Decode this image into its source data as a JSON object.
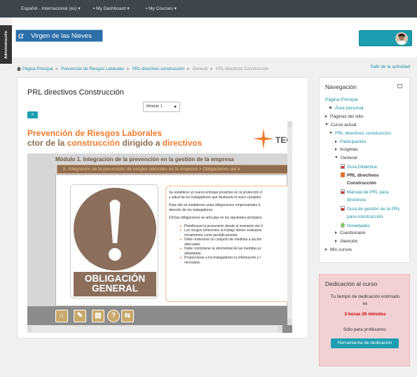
{
  "topbar": {
    "language": "Español - Internacional (es)",
    "dashboard": "My Dashboard",
    "courses": "My Courses"
  },
  "admin_tab": {
    "label": "Administración"
  },
  "header": {
    "logo_text": "Virgen de las Nieves",
    "logo_glyph": "α"
  },
  "breadcrumb": {
    "items": [
      "Página Principal",
      "Prevención de Riesgos Laborales",
      "PRL directivos construcción",
      "General",
      "PRL directivos Construcción"
    ],
    "separator": "►"
  },
  "exit_link": "Salir de la actividad",
  "main": {
    "title": "PRL directivos Construcción",
    "module_select": "Módulo 1",
    "next_button": ">"
  },
  "slide": {
    "title_line1": "Prevención de Riesgos Laborales",
    "title_line2_a": "ctor de la ",
    "title_line2_b": "construcción",
    "title_line2_c": " dirigido a ",
    "title_line2_d": "directivos",
    "logo_text": "TEC",
    "module_heading": "Módulo 1. Integración de la prevención en la gestión de la empresa",
    "section_heading": "5. Integración de la prevención de riesgos laborales en la empresa > Obligaciones del e",
    "sign_label_1": "OBLIGACIÓN",
    "sign_label_2": "GENERAL",
    "paragraphs": [
      "Se establece un nuevo enfoque proactivo en la protección d",
      "y salud de los trabajadores que desborda el mero cumplimi",
      "Para ello se establecen unas obligaciones empresariales d",
      "derecho de los trabajadores.",
      "Dichas obligaciones se articulan en los siguientes principios"
    ],
    "bullets": [
      "Planificarse la prevención desde el momento del d",
      "Los riesgos inherentes al trabajo deben evaluarse",
      "inicialmente como periódicamente.",
      "Debe ordenarse un conjunto de medidas a acción",
      "adecuada.",
      "Debe controlarse la efectividad de las medidas pr",
      "adoptadas.",
      "Proporcionar a los trabajadores la información y t",
      "necesaria."
    ],
    "tool_glyphs": [
      "⌂",
      "✎",
      "▤",
      "?",
      "⇆"
    ]
  },
  "navigation": {
    "title": "Navegación",
    "items": [
      {
        "label": "Página Principal",
        "kind": "link",
        "marker": "none",
        "indent": 0
      },
      {
        "label": "Área personal",
        "kind": "link",
        "marker": "bullet",
        "indent": 1
      },
      {
        "label": "Páginas del sitio",
        "kind": "plain",
        "marker": "right",
        "indent": 0
      },
      {
        "label": "Curso actual",
        "kind": "plain",
        "marker": "down",
        "indent": 0
      },
      {
        "label": "PRL directivos construcción",
        "kind": "link",
        "marker": "down",
        "indent": 1
      },
      {
        "label": "Participantes",
        "kind": "link",
        "marker": "right",
        "indent": 2
      },
      {
        "label": "Insignias",
        "kind": "plain",
        "marker": "right",
        "indent": 2
      },
      {
        "label": "General",
        "kind": "plain",
        "marker": "down",
        "indent": 2
      },
      {
        "label": "Guía Didáctica",
        "kind": "link",
        "marker": "pdf",
        "indent": 3
      },
      {
        "label": "PRL directivos",
        "kind": "active",
        "marker": "book",
        "indent": 3
      },
      {
        "label": "Construcción",
        "kind": "active",
        "marker": "none",
        "indent": 3
      },
      {
        "label": "Manual de PRL para",
        "kind": "link",
        "marker": "pdf",
        "indent": 3
      },
      {
        "label": "directivos",
        "kind": "link",
        "marker": "none",
        "indent": 3
      },
      {
        "label": "Guía de gestión de la PRL",
        "kind": "link",
        "marker": "pdf",
        "indent": 3
      },
      {
        "label": "para construcción",
        "kind": "link",
        "marker": "none",
        "indent": 3
      },
      {
        "label": "Novedades",
        "kind": "link",
        "marker": "forum",
        "indent": 3
      },
      {
        "label": "Cuestionario",
        "kind": "plain",
        "marker": "right",
        "indent": 2
      },
      {
        "label": "Atención",
        "kind": "plain",
        "marker": "right",
        "indent": 2
      },
      {
        "label": "Mis cursos",
        "kind": "plain",
        "marker": "right",
        "indent": 0
      }
    ]
  },
  "dedication": {
    "title": "Dedicación al curso",
    "estimate_label_1": "Tu tiempo de dedicación estimado",
    "estimate_label_2": "es",
    "time": "3 horas 26 minutos",
    "teachers_label": "Sólo para profesores:",
    "tool_button": "Herramienta de dedicación"
  },
  "colors": {
    "accent": "#1d9db0",
    "topbar": "#3f454b",
    "slide_orange": "#ef7b2d",
    "sign_brown": "#8b6f5c"
  }
}
